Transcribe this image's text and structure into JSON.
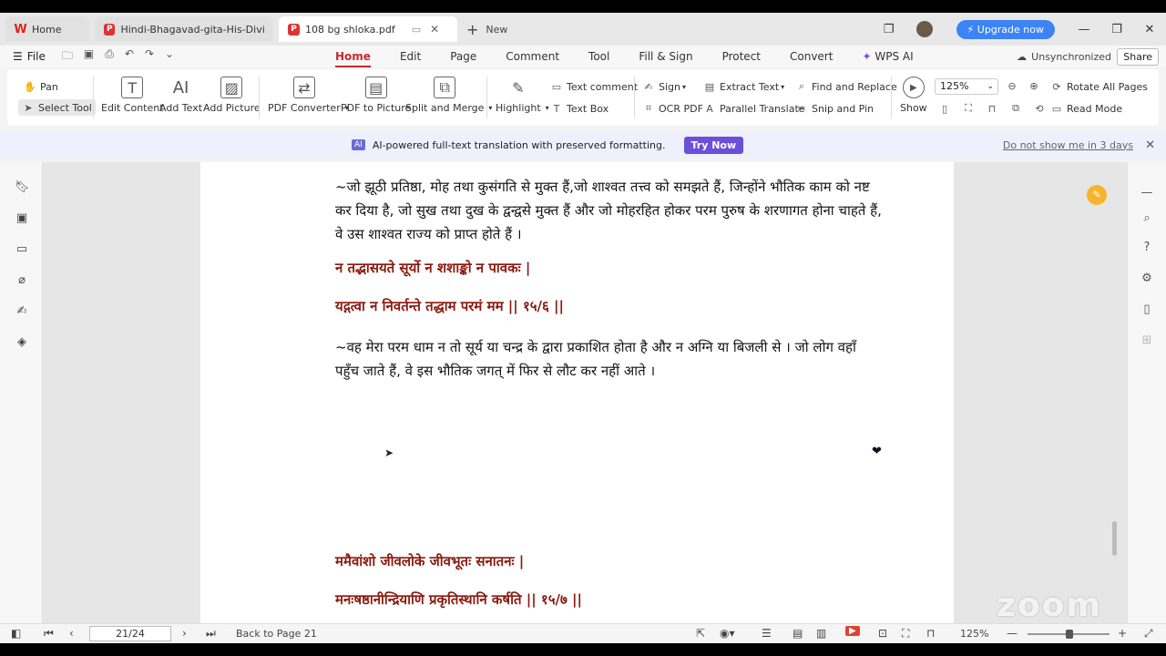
{
  "tabs": [
    {
      "label": "Home",
      "icon": "wps-logo-icon"
    },
    {
      "label": "Hindi-Bhagavad-gita-His-Divine-Gra",
      "icon": "pdf-icon"
    },
    {
      "label": "108 bg shloka.pdf",
      "icon": "pdf-icon",
      "active": true
    }
  ],
  "new_tab_label": "New",
  "upgrade_label": "Upgrade now",
  "menu": {
    "file": "File",
    "tabs": [
      "Home",
      "Edit",
      "Page",
      "Comment",
      "Tool",
      "Fill & Sign",
      "Protect",
      "Convert",
      "WPS AI"
    ],
    "active_tab": "Home",
    "sync": "Unsynchronized",
    "share": "Share"
  },
  "ribbon": {
    "pan": "Pan",
    "select_tool": "Select Tool",
    "edit_content": "Edit Content",
    "add_text": "Add Text",
    "add_picture": "Add Picture",
    "pdf_converter": "PDF Converter",
    "pdf_to_picture": "PDF to Picture",
    "split_merge": "Split and Merge",
    "highlight": "Highlight",
    "text_comment": "Text comment",
    "text_box": "Text Box",
    "sign": "Sign",
    "ocr_pdf": "OCR PDF",
    "extract_text": "Extract Text",
    "parallel_translate": "Parallel Translate",
    "find_replace": "Find and Replace",
    "snip_pin": "Snip and Pin",
    "show": "Show",
    "zoom": "125%",
    "rotate_all": "Rotate All Pages",
    "read_mode": "Read Mode"
  },
  "banner": {
    "icon_text": "AI",
    "message": "AI-powered full-text translation with preserved formatting.",
    "try_now": "Try Now",
    "dismiss": "Do not show me in 3 days"
  },
  "document": {
    "para1": "~जो झूठी प्रतिष्ठा, मोह तथा कुसंगति से मुक्त हैं,जो शाश्वत तत्त्व को समझते हैं, जिन्होंने भौतिक काम को नष्ट कर दिया है, जो सुख तथा दुख के द्वन्द्वसे मुक्त हैं और जो मोहरहित होकर परम पुरुष के शरणागत होना चाहते हैं, वे उस शाश्वत राज्य को प्राप्त होते हैं ।",
    "shloka1_line1": "न तद्भासयते सूर्यो न शशाङ्को न पावकः |",
    "shloka1_line2": "यद्गत्वा न निवर्तन्ते तद्धाम परमं मम || १५/६ ||",
    "para2": "~वह मेरा परम धाम न तो सूर्य या चन्द्र के द्वारा प्रकाशित होता है और न अग्नि या बिजली से । जो लोग वहाँ पहुँच जाते हैं, वे इस भौतिक जगत् में फिर से लौट कर नहीं आते ।",
    "shloka2_line1": "ममैवांशो जीवलोके जीवभूतः सनातनः |",
    "shloka2_line2": "मनःषष्ठानीन्द्रियाणि प्रकृतिस्थानि कर्षति || १५/७ ||"
  },
  "status": {
    "page": "21/24",
    "back": "Back to Page 21",
    "zoom": "125%"
  },
  "watermark": "zoom"
}
